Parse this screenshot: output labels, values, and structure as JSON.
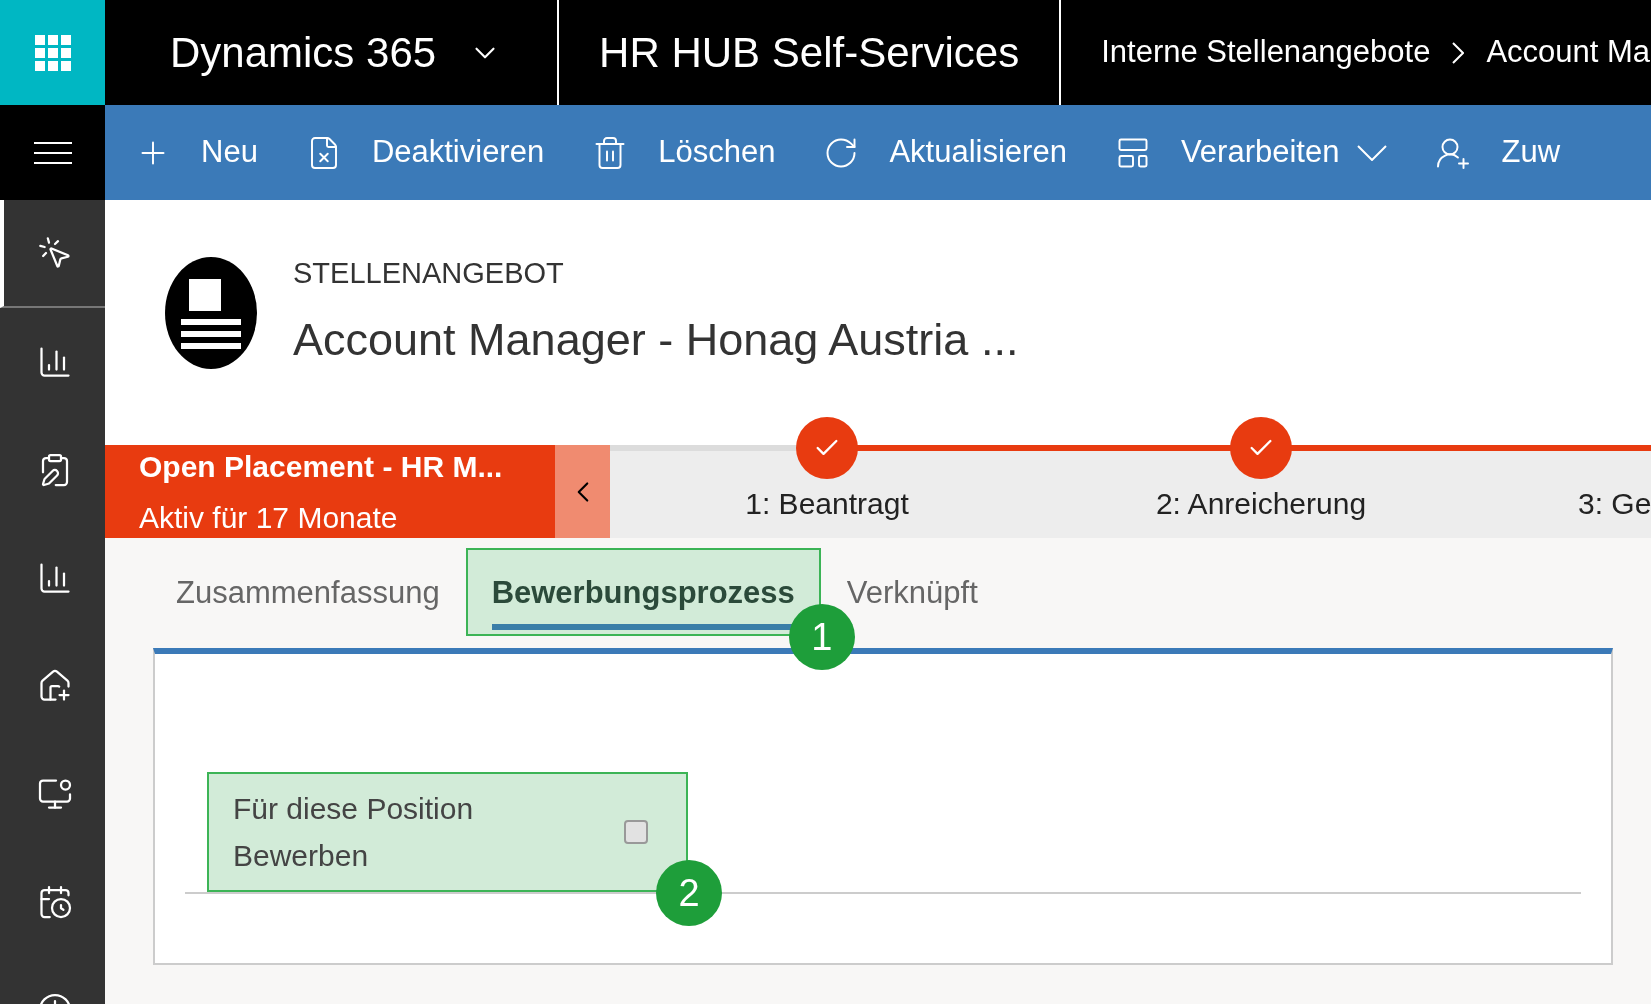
{
  "top_bar": {
    "app_name": "Dynamics 365",
    "area": "HR HUB Self-Services",
    "breadcrumb": [
      "Interne Stellenangebote",
      "Account Ma"
    ]
  },
  "sidebar": {
    "items": [
      {
        "selected": true
      },
      {
        "selected": false
      },
      {
        "selected": false
      },
      {
        "selected": false
      },
      {
        "selected": false
      },
      {
        "selected": false
      },
      {
        "selected": false
      },
      {
        "selected": false
      }
    ]
  },
  "command_bar": [
    {
      "label": "Neu",
      "dropdown": false
    },
    {
      "label": "Deaktivieren",
      "dropdown": false
    },
    {
      "label": "Löschen",
      "dropdown": false
    },
    {
      "label": "Aktualisieren",
      "dropdown": false
    },
    {
      "label": "Verarbeiten",
      "dropdown": true
    },
    {
      "label": "Zuw",
      "dropdown": false
    }
  ],
  "record": {
    "entity": "STELLENANGEBOT",
    "title": "Account Manager - Honag Austria ..."
  },
  "process": {
    "name": "Open Placement - HR M...",
    "status": "Aktiv für 17 Monate",
    "stages": [
      {
        "label": "1: Beantragt",
        "completed": true
      },
      {
        "label": "2: Anreicherung",
        "completed": true
      },
      {
        "label": "3: Ge"
      }
    ]
  },
  "tabs": [
    {
      "label": "Zusammenfassung",
      "selected": false,
      "highlighted": false
    },
    {
      "label": "Bewerbungsprozess",
      "selected": true,
      "highlighted": true,
      "callout": "1"
    },
    {
      "label": "Verknüpft",
      "selected": false,
      "highlighted": false
    }
  ],
  "form": {
    "field": {
      "label": "Für diese Position Bewerben",
      "checked": false,
      "highlighted": true,
      "callout": "2"
    }
  }
}
